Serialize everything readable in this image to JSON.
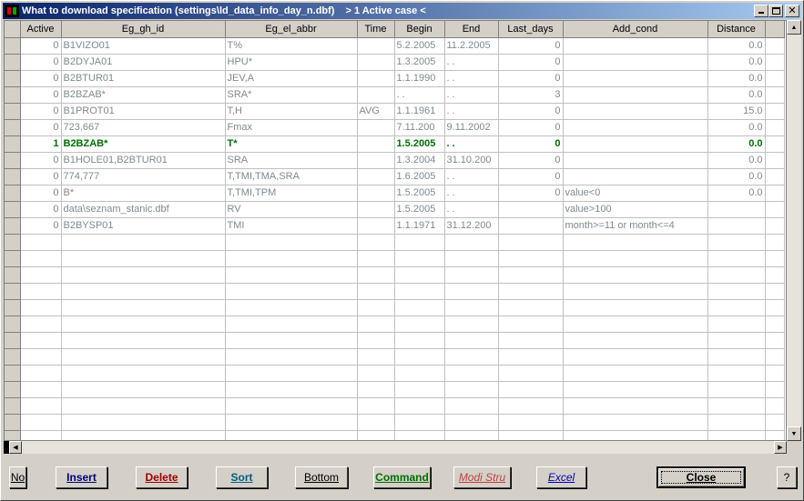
{
  "window": {
    "title": "What to download specification (settings\\ld_data_info_day_n.dbf)",
    "title_extra": "> 1 Active case <"
  },
  "table": {
    "columns": [
      "Active",
      "Eg_gh_id",
      "Eg_el_abbr",
      "Time",
      "Begin",
      "End",
      "Last_days",
      "Add_cond",
      "Distance"
    ],
    "rows": [
      {
        "active": "0",
        "gh_id": "B1VIZO01",
        "el_abbr": "T%",
        "time": "",
        "begin": "5.2.2005",
        "end": "11.2.2005",
        "last_days": "0",
        "add_cond": "",
        "distance": "0.0",
        "is_active": false
      },
      {
        "active": "0",
        "gh_id": "B2DYJA01",
        "el_abbr": "HPU*",
        "time": "",
        "begin": "1.3.2005",
        "end": ". .",
        "last_days": "0",
        "add_cond": "",
        "distance": "0.0",
        "is_active": false
      },
      {
        "active": "0",
        "gh_id": "B2BTUR01",
        "el_abbr": "JEV,A",
        "time": "",
        "begin": "1.1.1990",
        "end": ". .",
        "last_days": "0",
        "add_cond": "",
        "distance": "0.0",
        "is_active": false
      },
      {
        "active": "0",
        "gh_id": "B2BZAB*",
        "el_abbr": "SRA*",
        "time": "",
        "begin": ". .",
        "end": ". .",
        "last_days": "3",
        "add_cond": "",
        "distance": "0.0",
        "is_active": false
      },
      {
        "active": "0",
        "gh_id": "B1PROT01",
        "el_abbr": "T,H",
        "time": "AVG",
        "begin": "1.1.1961",
        "end": ". .",
        "last_days": "0",
        "add_cond": "",
        "distance": "15.0",
        "is_active": false
      },
      {
        "active": "0",
        "gh_id": "723,667",
        "el_abbr": "Fmax",
        "time": "",
        "begin": "7.11.200",
        "end": "9.11.2002",
        "last_days": "0",
        "add_cond": "",
        "distance": "0.0",
        "is_active": false
      },
      {
        "active": "1",
        "gh_id": "B2BZAB*",
        "el_abbr": "T*",
        "time": "",
        "begin": "1.5.2005",
        "end": ". .",
        "last_days": "0",
        "add_cond": "",
        "distance": "0.0",
        "is_active": true
      },
      {
        "active": "0",
        "gh_id": "B1HOLE01,B2BTUR01",
        "el_abbr": "SRA",
        "time": "",
        "begin": "1.3.2004",
        "end": "31.10.200",
        "last_days": "0",
        "add_cond": "",
        "distance": "0.0",
        "is_active": false
      },
      {
        "active": "0",
        "gh_id": "774,777",
        "el_abbr": "T,TMI,TMA,SRA",
        "time": "",
        "begin": "1.6.2005",
        "end": ". .",
        "last_days": "0",
        "add_cond": "",
        "distance": "0.0",
        "is_active": false
      },
      {
        "active": "0",
        "gh_id": "B*",
        "el_abbr": "T,TMI,TPM",
        "time": "",
        "begin": "1.5.2005",
        "end": ". .",
        "last_days": "0",
        "add_cond": "value<0",
        "distance": "0.0",
        "is_active": false
      },
      {
        "active": "0",
        "gh_id": "data\\seznam_stanic.dbf",
        "el_abbr": "RV",
        "time": "",
        "begin": "1.5.2005",
        "end": ". .",
        "last_days": "",
        "add_cond": "value>100",
        "distance": "",
        "is_active": false
      },
      {
        "active": "0",
        "gh_id": "B2BYSP01",
        "el_abbr": "TMI",
        "time": "",
        "begin": "1.1.1971",
        "end": "31.12.200",
        "last_days": "",
        "add_cond": "month>=11 or month<=4",
        "distance": "",
        "is_active": false
      }
    ]
  },
  "buttons": {
    "no": "No",
    "insert": "Insert",
    "delete": "Delete",
    "sort": "Sort",
    "bottom": "Bottom",
    "command": "Command",
    "modi_stru": "Modi Stru",
    "excel": "Excel",
    "close": "Close",
    "help": "?"
  },
  "colors": {
    "title_start": "#0a246a",
    "title_end": "#a6caf0",
    "row_text": "#7f8a8f",
    "active_row_text": "#007000",
    "insert_text": "#000080",
    "delete_text": "#a00000",
    "sort_text": "#006080",
    "command_text": "#007000",
    "modi_stru_text": "#c04040",
    "excel_text": "#0000c0"
  }
}
